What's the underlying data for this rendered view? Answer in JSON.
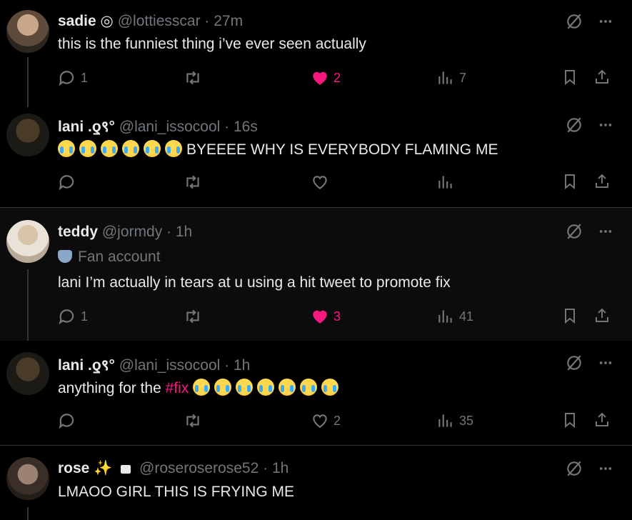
{
  "tweets": [
    {
      "name": "sadie",
      "name_suffix": " ◎",
      "handle": "@lottiesscar",
      "time": "27m",
      "text": "this is the funniest thing i’ve ever seen actually",
      "replies": "1",
      "likes": "2",
      "views": "7",
      "liked": true
    },
    {
      "name": "lani",
      "name_suffix": " .ƍ९°",
      "handle": "@lani_issocool",
      "time": "16s",
      "emoji_count": 6,
      "text": "BYEEEE WHY IS EVERYBODY FLAMING ME",
      "replies": "",
      "likes": "",
      "views": "",
      "liked": false
    },
    {
      "name": "teddy",
      "name_suffix": "",
      "handle": "@jormdy",
      "time": "1h",
      "fan_label": "Fan account",
      "text": "lani I’m actually in tears at u using a hit tweet to promote fix",
      "replies": "1",
      "likes": "3",
      "views": "41",
      "liked": true
    },
    {
      "name": "lani",
      "name_suffix": " .ƍ९°",
      "handle": "@lani_issocool",
      "time": "1h",
      "text_prefix": "anything for the ",
      "hashtag": "#fix",
      "emoji_count": 7,
      "replies": "",
      "likes": "2",
      "views": "35",
      "liked": false
    },
    {
      "name": "rose",
      "name_suffix": " ✨",
      "handle": "@roseroserose52",
      "time": "1h",
      "text": "LMAOO GIRL THIS IS FRYING ME"
    }
  ],
  "separator": " · ",
  "colors": {
    "accent_like": "#f91880",
    "muted": "#71767b",
    "text": "#e7e9ea"
  },
  "icons": [
    "grok-icon",
    "more-icon",
    "reply-icon",
    "retweet-icon",
    "heart-icon",
    "views-icon",
    "bookmark-icon",
    "share-icon",
    "lock-icon",
    "mask-icon"
  ]
}
